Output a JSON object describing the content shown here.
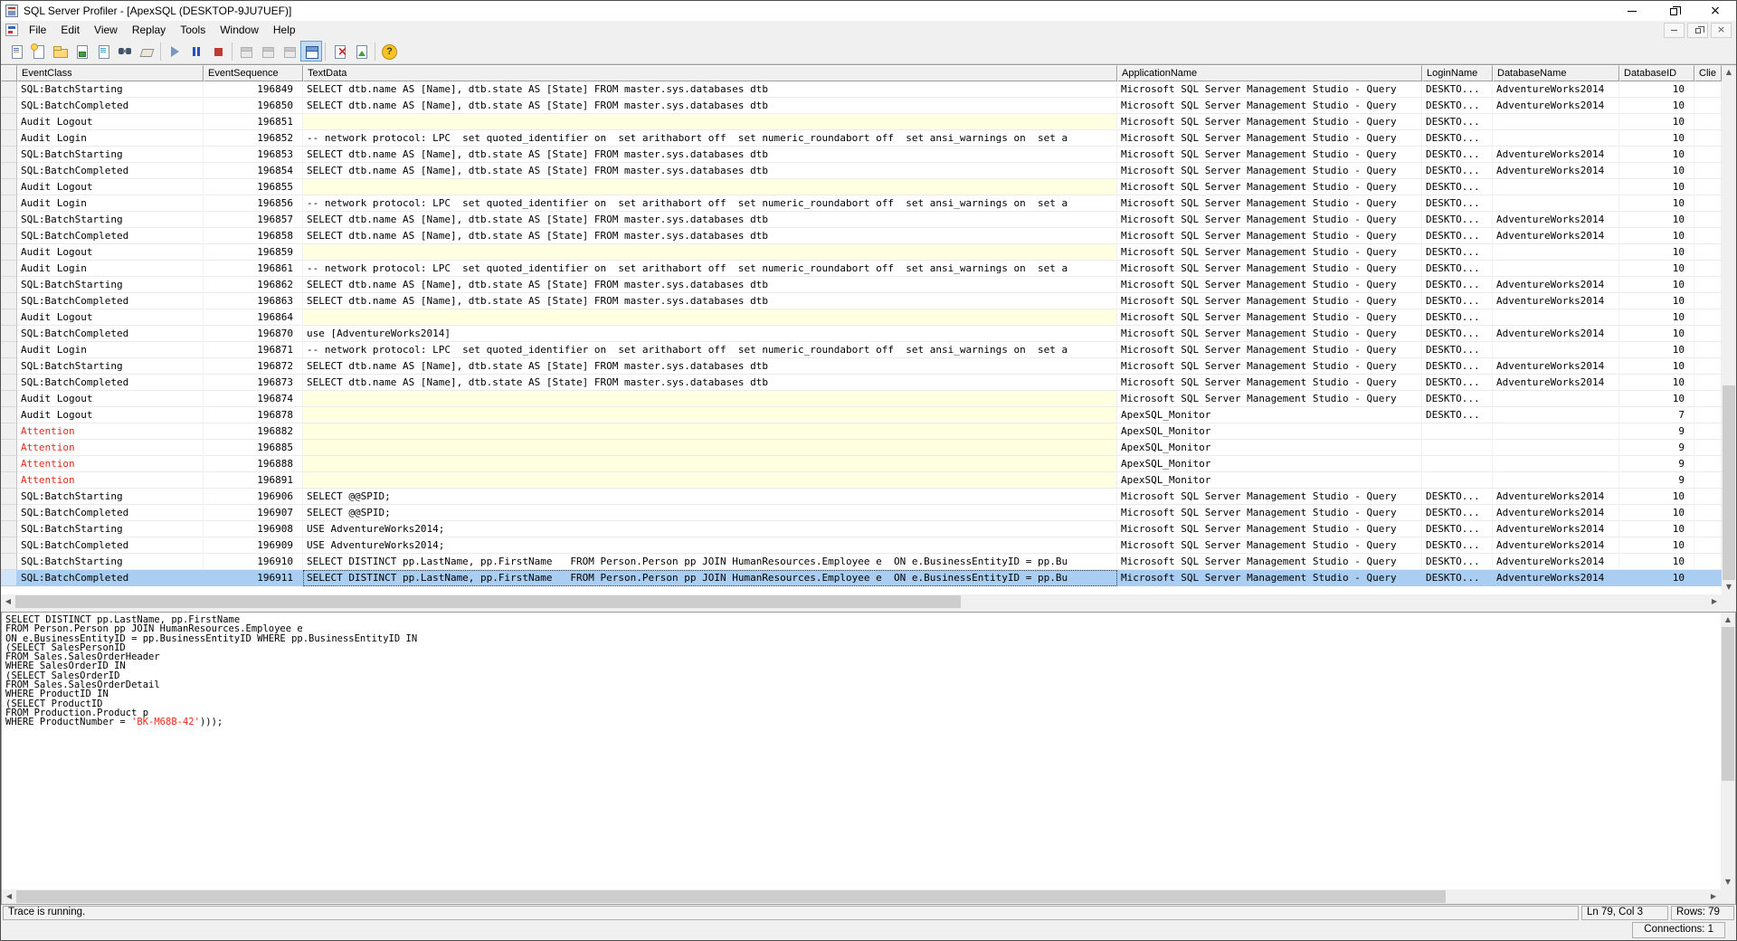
{
  "window": {
    "title": "SQL Server Profiler - [ApexSQL (DESKTOP-9JU7UEF)]"
  },
  "menu": {
    "items": [
      "File",
      "Edit",
      "View",
      "Replay",
      "Tools",
      "Window",
      "Help"
    ]
  },
  "toolbar": {
    "buttons": [
      "new-trace",
      "new-template",
      "open-trace",
      "save-trace",
      "trace-properties",
      "find",
      "eraser",
      "|",
      "play",
      "pause",
      "stop",
      "|",
      "window-1-disabled",
      "window-2-disabled",
      "window-3-disabled",
      "auto-scroll-pressed",
      "|",
      "clear-x",
      "chart",
      "|",
      "help"
    ]
  },
  "colors": {
    "selection": "#aacdf2",
    "empty_cell": "#ffffe1",
    "attention_text": "#e8291c"
  },
  "grid": {
    "columns": [
      "",
      "EventClass",
      "EventSequence",
      "TextData",
      "ApplicationName",
      "LoginName",
      "DatabaseName",
      "DatabaseID",
      "Clie"
    ],
    "rows": [
      {
        "ec": "SQL:BatchStarting",
        "seq": "196849",
        "txt": "SELECT dtb.name AS [Name], dtb.state AS [State] FROM master.sys.databases dtb",
        "app": "Microsoft SQL Server Management Studio - Query",
        "lg": "DESKTO...",
        "db": "AdventureWorks2014",
        "id": "10",
        "type": "normal"
      },
      {
        "ec": "SQL:BatchCompleted",
        "seq": "196850",
        "txt": "SELECT dtb.name AS [Name], dtb.state AS [State] FROM master.sys.databases dtb",
        "app": "Microsoft SQL Server Management Studio - Query",
        "lg": "DESKTO...",
        "db": "AdventureWorks2014",
        "id": "10",
        "type": "normal"
      },
      {
        "ec": "Audit Logout",
        "seq": "196851",
        "txt": "",
        "app": "Microsoft SQL Server Management Studio - Query",
        "lg": "DESKTO...",
        "db": "",
        "id": "10",
        "type": "normal"
      },
      {
        "ec": "Audit Login",
        "seq": "196852",
        "txt": "-- network protocol: LPC  set quoted_identifier on  set arithabort off  set numeric_roundabort off  set ansi_warnings on  set a",
        "app": "Microsoft SQL Server Management Studio - Query",
        "lg": "DESKTO...",
        "db": "",
        "id": "10",
        "type": "normal"
      },
      {
        "ec": "SQL:BatchStarting",
        "seq": "196853",
        "txt": "SELECT dtb.name AS [Name], dtb.state AS [State] FROM master.sys.databases dtb",
        "app": "Microsoft SQL Server Management Studio - Query",
        "lg": "DESKTO...",
        "db": "AdventureWorks2014",
        "id": "10",
        "type": "normal"
      },
      {
        "ec": "SQL:BatchCompleted",
        "seq": "196854",
        "txt": "SELECT dtb.name AS [Name], dtb.state AS [State] FROM master.sys.databases dtb",
        "app": "Microsoft SQL Server Management Studio - Query",
        "lg": "DESKTO...",
        "db": "AdventureWorks2014",
        "id": "10",
        "type": "normal"
      },
      {
        "ec": "Audit Logout",
        "seq": "196855",
        "txt": "",
        "app": "Microsoft SQL Server Management Studio - Query",
        "lg": "DESKTO...",
        "db": "",
        "id": "10",
        "type": "normal"
      },
      {
        "ec": "Audit Login",
        "seq": "196856",
        "txt": "-- network protocol: LPC  set quoted_identifier on  set arithabort off  set numeric_roundabort off  set ansi_warnings on  set a",
        "app": "Microsoft SQL Server Management Studio - Query",
        "lg": "DESKTO...",
        "db": "",
        "id": "10",
        "type": "normal"
      },
      {
        "ec": "SQL:BatchStarting",
        "seq": "196857",
        "txt": "SELECT dtb.name AS [Name], dtb.state AS [State] FROM master.sys.databases dtb",
        "app": "Microsoft SQL Server Management Studio - Query",
        "lg": "DESKTO...",
        "db": "AdventureWorks2014",
        "id": "10",
        "type": "normal"
      },
      {
        "ec": "SQL:BatchCompleted",
        "seq": "196858",
        "txt": "SELECT dtb.name AS [Name], dtb.state AS [State] FROM master.sys.databases dtb",
        "app": "Microsoft SQL Server Management Studio - Query",
        "lg": "DESKTO...",
        "db": "AdventureWorks2014",
        "id": "10",
        "type": "normal"
      },
      {
        "ec": "Audit Logout",
        "seq": "196859",
        "txt": "",
        "app": "Microsoft SQL Server Management Studio - Query",
        "lg": "DESKTO...",
        "db": "",
        "id": "10",
        "type": "normal"
      },
      {
        "ec": "Audit Login",
        "seq": "196861",
        "txt": "-- network protocol: LPC  set quoted_identifier on  set arithabort off  set numeric_roundabort off  set ansi_warnings on  set a",
        "app": "Microsoft SQL Server Management Studio - Query",
        "lg": "DESKTO...",
        "db": "",
        "id": "10",
        "type": "normal"
      },
      {
        "ec": "SQL:BatchStarting",
        "seq": "196862",
        "txt": "SELECT dtb.name AS [Name], dtb.state AS [State] FROM master.sys.databases dtb",
        "app": "Microsoft SQL Server Management Studio - Query",
        "lg": "DESKTO...",
        "db": "AdventureWorks2014",
        "id": "10",
        "type": "normal"
      },
      {
        "ec": "SQL:BatchCompleted",
        "seq": "196863",
        "txt": "SELECT dtb.name AS [Name], dtb.state AS [State] FROM master.sys.databases dtb",
        "app": "Microsoft SQL Server Management Studio - Query",
        "lg": "DESKTO...",
        "db": "AdventureWorks2014",
        "id": "10",
        "type": "normal"
      },
      {
        "ec": "Audit Logout",
        "seq": "196864",
        "txt": "",
        "app": "Microsoft SQL Server Management Studio - Query",
        "lg": "DESKTO...",
        "db": "",
        "id": "10",
        "type": "normal"
      },
      {
        "ec": "SQL:BatchCompleted",
        "seq": "196870",
        "txt": "use [AdventureWorks2014]",
        "app": "Microsoft SQL Server Management Studio - Query",
        "lg": "DESKTO...",
        "db": "AdventureWorks2014",
        "id": "10",
        "type": "normal"
      },
      {
        "ec": "Audit Login",
        "seq": "196871",
        "txt": "-- network protocol: LPC  set quoted_identifier on  set arithabort off  set numeric_roundabort off  set ansi_warnings on  set a",
        "app": "Microsoft SQL Server Management Studio - Query",
        "lg": "DESKTO...",
        "db": "",
        "id": "10",
        "type": "normal"
      },
      {
        "ec": "SQL:BatchStarting",
        "seq": "196872",
        "txt": "SELECT dtb.name AS [Name], dtb.state AS [State] FROM master.sys.databases dtb",
        "app": "Microsoft SQL Server Management Studio - Query",
        "lg": "DESKTO...",
        "db": "AdventureWorks2014",
        "id": "10",
        "type": "normal"
      },
      {
        "ec": "SQL:BatchCompleted",
        "seq": "196873",
        "txt": "SELECT dtb.name AS [Name], dtb.state AS [State] FROM master.sys.databases dtb",
        "app": "Microsoft SQL Server Management Studio - Query",
        "lg": "DESKTO...",
        "db": "AdventureWorks2014",
        "id": "10",
        "type": "normal"
      },
      {
        "ec": "Audit Logout",
        "seq": "196874",
        "txt": "",
        "app": "Microsoft SQL Server Management Studio - Query",
        "lg": "DESKTO...",
        "db": "",
        "id": "10",
        "type": "normal"
      },
      {
        "ec": "Audit Logout",
        "seq": "196878",
        "txt": "",
        "app": "ApexSQL_Monitor",
        "lg": "DESKTO...",
        "db": "",
        "id": "7",
        "type": "normal"
      },
      {
        "ec": "Attention",
        "seq": "196882",
        "txt": "",
        "app": "ApexSQL_Monitor",
        "lg": "",
        "db": "",
        "id": "9",
        "type": "attention"
      },
      {
        "ec": "Attention",
        "seq": "196885",
        "txt": "",
        "app": "ApexSQL_Monitor",
        "lg": "",
        "db": "",
        "id": "9",
        "type": "attention"
      },
      {
        "ec": "Attention",
        "seq": "196888",
        "txt": "",
        "app": "ApexSQL_Monitor",
        "lg": "",
        "db": "",
        "id": "9",
        "type": "attention"
      },
      {
        "ec": "Attention",
        "seq": "196891",
        "txt": "",
        "app": "ApexSQL_Monitor",
        "lg": "",
        "db": "",
        "id": "9",
        "type": "attention"
      },
      {
        "ec": "SQL:BatchStarting",
        "seq": "196906",
        "txt": "SELECT @@SPID;",
        "app": "Microsoft SQL Server Management Studio - Query",
        "lg": "DESKTO...",
        "db": "AdventureWorks2014",
        "id": "10",
        "type": "normal"
      },
      {
        "ec": "SQL:BatchCompleted",
        "seq": "196907",
        "txt": "SELECT @@SPID;",
        "app": "Microsoft SQL Server Management Studio - Query",
        "lg": "DESKTO...",
        "db": "AdventureWorks2014",
        "id": "10",
        "type": "normal"
      },
      {
        "ec": "SQL:BatchStarting",
        "seq": "196908",
        "txt": "USE AdventureWorks2014;",
        "app": "Microsoft SQL Server Management Studio - Query",
        "lg": "DESKTO...",
        "db": "AdventureWorks2014",
        "id": "10",
        "type": "normal"
      },
      {
        "ec": "SQL:BatchCompleted",
        "seq": "196909",
        "txt": "USE AdventureWorks2014;",
        "app": "Microsoft SQL Server Management Studio - Query",
        "lg": "DESKTO...",
        "db": "AdventureWorks2014",
        "id": "10",
        "type": "normal"
      },
      {
        "ec": "SQL:BatchStarting",
        "seq": "196910",
        "txt": "SELECT DISTINCT pp.LastName, pp.FirstName   FROM Person.Person pp JOIN HumanResources.Employee e  ON e.BusinessEntityID = pp.Bu",
        "app": "Microsoft SQL Server Management Studio - Query",
        "lg": "DESKTO...",
        "db": "AdventureWorks2014",
        "id": "10",
        "type": "normal"
      },
      {
        "ec": "SQL:BatchCompleted",
        "seq": "196911",
        "txt": "SELECT DISTINCT pp.LastName, pp.FirstName   FROM Person.Person pp JOIN HumanResources.Employee e  ON e.BusinessEntityID = pp.Bu",
        "app": "Microsoft SQL Server Management Studio - Query",
        "lg": "DESKTO...",
        "db": "AdventureWorks2014",
        "id": "10",
        "type": "selected"
      }
    ]
  },
  "detail": {
    "sql_lines": [
      "SELECT DISTINCT pp.LastName, pp.FirstName",
      "FROM Person.Person pp JOIN HumanResources.Employee e",
      "ON e.BusinessEntityID = pp.BusinessEntityID WHERE pp.BusinessEntityID IN",
      "(SELECT SalesPersonID",
      "FROM Sales.SalesOrderHeader",
      "WHERE SalesOrderID IN",
      "(SELECT SalesOrderID",
      "FROM Sales.SalesOrderDetail",
      "WHERE ProductID IN",
      "(SELECT ProductID",
      "FROM Production.Product p",
      "WHERE ProductNumber = 'BK-M68B-42')));"
    ],
    "red_token": "'BK-M68B-42'"
  },
  "status": {
    "message": "Trace is running.",
    "position": "Ln 79, Col 3",
    "rows": "Rows: 79",
    "connections": "Connections: 1"
  }
}
